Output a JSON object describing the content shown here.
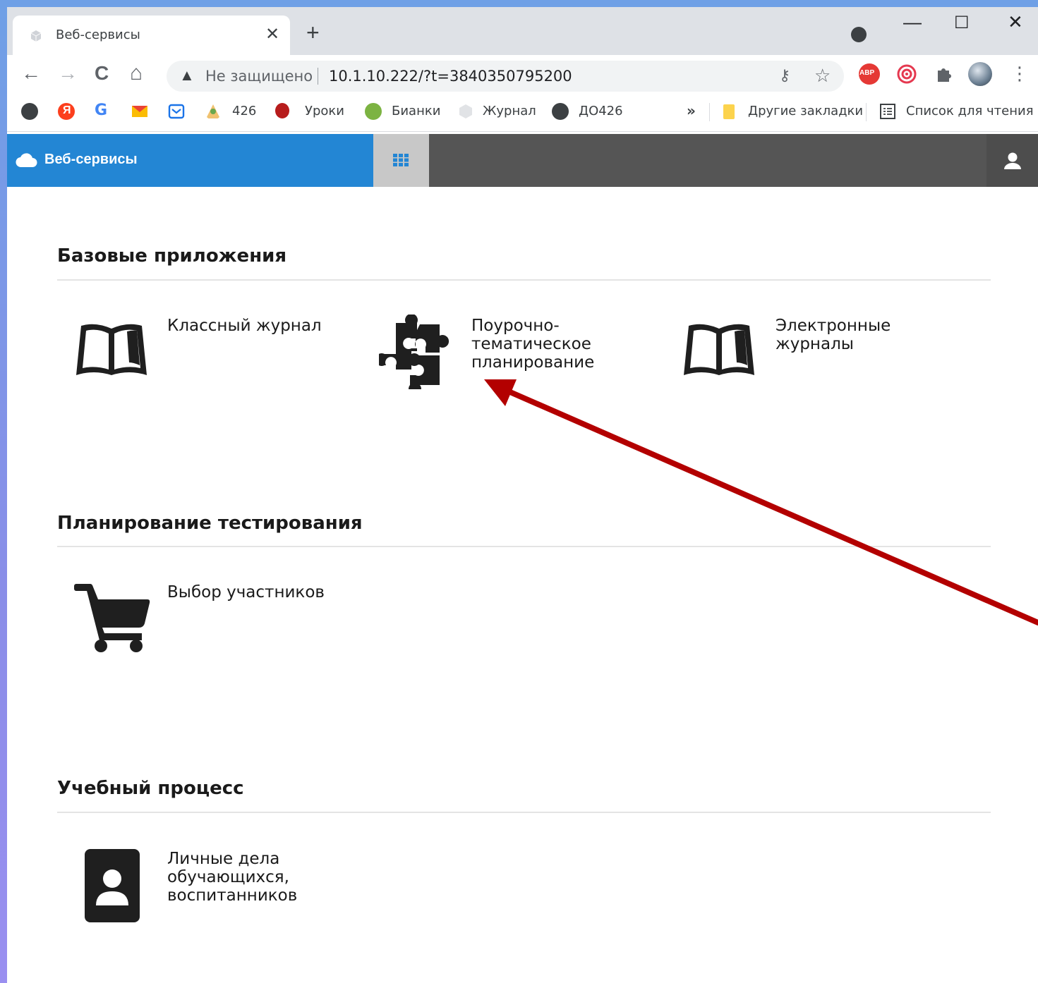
{
  "browser": {
    "tab": {
      "title": "Веб-сервисы",
      "close_glyph": "✕"
    },
    "new_tab_glyph": "+",
    "window_controls": {
      "minimize": "—",
      "maximize": "☐",
      "close": "✕"
    },
    "nav": {
      "back": "←",
      "forward": "→",
      "reload": "C",
      "home": "⌂"
    },
    "omnibox": {
      "security_label": "Не защищено",
      "url": "10.1.10.222/?t=3840350795200"
    },
    "extensions": {
      "abp_label": "ABP",
      "menu_glyph": "⋮"
    },
    "bookmarks": [
      {
        "label": "",
        "icon": "globe-icon"
      },
      {
        "label": "",
        "icon": "yandex-icon"
      },
      {
        "label": "",
        "icon": "google-icon"
      },
      {
        "label": "",
        "icon": "mail-icon"
      },
      {
        "label": "",
        "icon": "envelope-icon"
      },
      {
        "label": "426",
        "icon": "person-icon"
      },
      {
        "label": "Уроки",
        "icon": "apple-icon"
      },
      {
        "label": "Бианки",
        "icon": "frog-icon"
      },
      {
        "label": "Журнал",
        "icon": "page-icon"
      },
      {
        "label": "ДО426",
        "icon": "globe-icon"
      }
    ],
    "bookmarks_overflow": "»",
    "other_bookmarks": "Другие закладки",
    "reading_list": "Список для чтения"
  },
  "app": {
    "brand": "Веб-сервисы",
    "sections": [
      {
        "title": "Базовые приложения",
        "tiles": [
          {
            "icon": "book-icon",
            "lines": [
              "Классный журнал"
            ]
          },
          {
            "icon": "puzzle-icon",
            "lines": [
              "Поурочно-",
              "тематическое",
              "планирование"
            ]
          },
          {
            "icon": "book-icon",
            "lines": [
              "Электронные",
              "журналы"
            ]
          }
        ]
      },
      {
        "title": "Планирование тестирования",
        "tiles": [
          {
            "icon": "cart-icon",
            "lines": [
              "Выбор участников"
            ]
          }
        ]
      },
      {
        "title": "Учебный процесс",
        "tiles": [
          {
            "icon": "profile-card-icon",
            "lines": [
              "Личные дела",
              "обучающихся,",
              "воспитанников"
            ]
          }
        ]
      }
    ]
  },
  "colors": {
    "brand_blue": "#2386d4",
    "header_dark": "#555555",
    "annotation_arrow": "#b30000"
  }
}
